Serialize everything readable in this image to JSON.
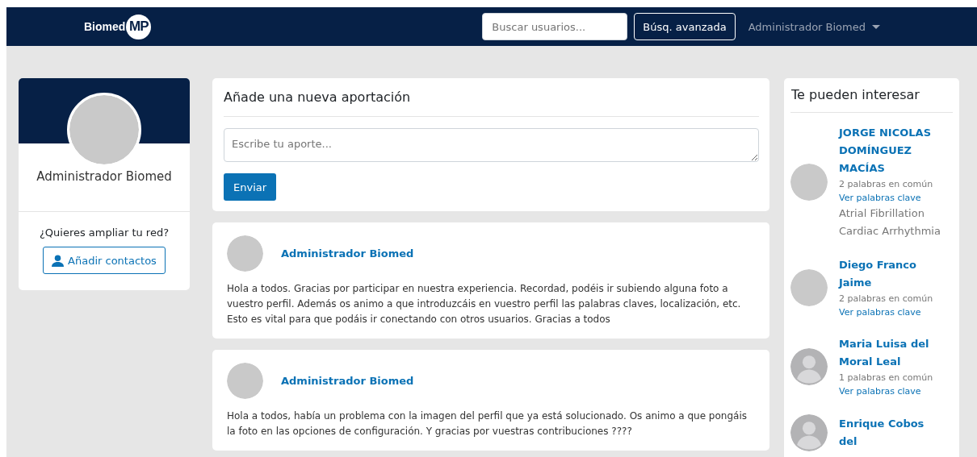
{
  "navbar": {
    "brand": "Biomed",
    "brand_badge": "MP",
    "search": {
      "placeholder": "Buscar usuarios..."
    },
    "advanced_button": "Búsq. avanzada",
    "user_menu": "Administrador Biomed"
  },
  "profile": {
    "name": "Administrador Biomed",
    "prompt": "¿Quieres ampliar tu red?",
    "add_button": "Añadir contactos"
  },
  "composer": {
    "title": "Añade una nueva aportación",
    "placeholder": "Escribe tu aporte...",
    "submit": "Enviar"
  },
  "posts": [
    {
      "author": "Administrador Biomed",
      "text": "Hola a todos. Gracias por participar en nuestra experiencia. Recordad, podéis ir subiendo alguna foto a vuestro perfil. Además os animo a que introduzcáis en vuestro perfil las palabras claves, localización, etc. Esto es vital para que podáis ir conectando con otros usuarios. Gracias a todos"
    },
    {
      "author": "Administrador Biomed",
      "text": "Hola a todos, había un problema con la imagen del perfil que ya está solucionado. Os animo a que pongáis la foto en las opciones de configuración. Y gracias por vuestras contribuciones ????"
    }
  ],
  "suggestions": {
    "title": "Te pueden interesar",
    "items": [
      {
        "kind": "photo",
        "name": "JORGE NICOLAS DOMÍNGUEZ MACÍAS",
        "common": "2 palabras en común",
        "link": "Ver palabras clave",
        "keywords": [
          "Atrial Fibrillation",
          "Cardiac Arrhythmia"
        ]
      },
      {
        "kind": "photo",
        "name": "Diego Franco Jaime",
        "common": "2 palabras en común",
        "link": "Ver palabras clave"
      },
      {
        "kind": "default",
        "name": "Maria Luisa del Moral Leal",
        "common": "1 palabras en común",
        "link": "Ver palabras clave"
      },
      {
        "kind": "default",
        "name": "Enrique Cobos del"
      }
    ]
  }
}
